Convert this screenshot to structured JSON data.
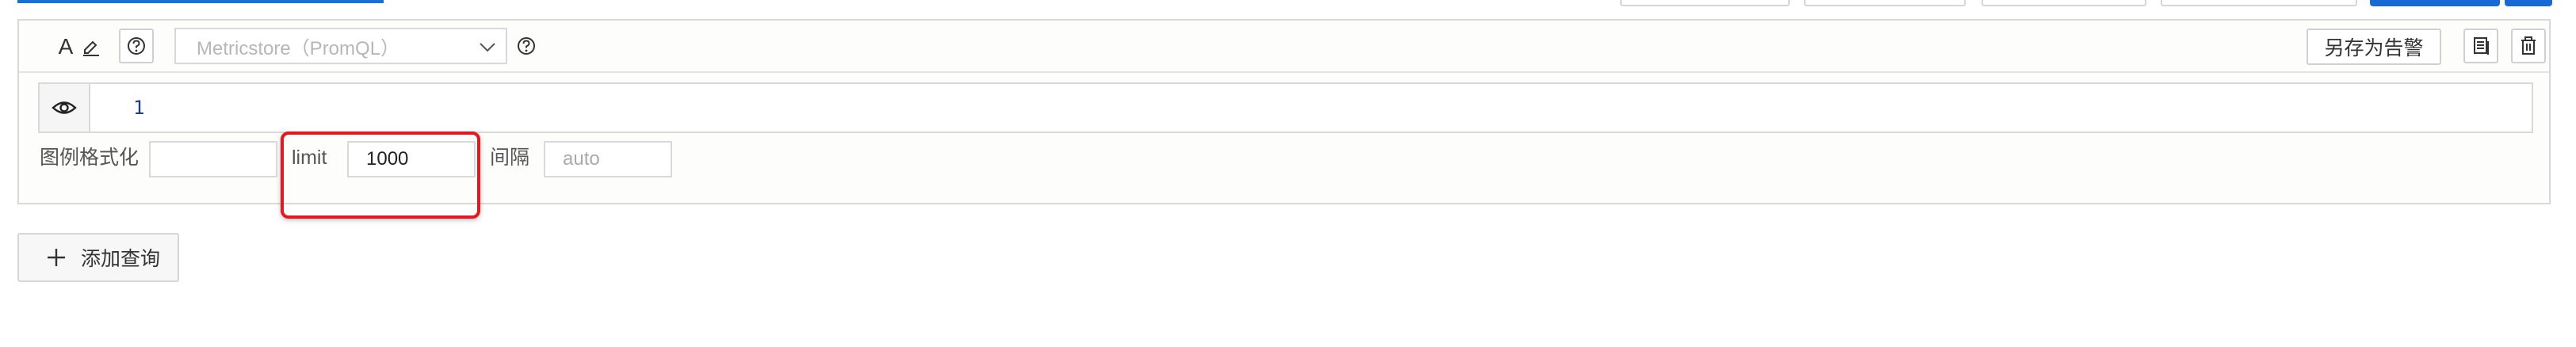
{
  "toolbar": {
    "text_mode_label": "A",
    "datasource_placeholder": "Metricstore（PromQL）",
    "save_alarm_label": "另存为告警",
    "icons": [
      "text-icon",
      "edit-icon",
      "help-icon",
      "chevron-down-icon",
      "help-icon",
      "copy-icon",
      "trash-icon"
    ]
  },
  "query": {
    "line_number": "1",
    "visibility_icon": "eye-icon"
  },
  "options": {
    "legend_label": "图例格式化",
    "legend_value": "",
    "limit_label": "limit",
    "limit_value": "1000",
    "interval_label": "间隔",
    "interval_placeholder": "auto"
  },
  "add_query_label": "添加查询",
  "colors": {
    "highlight": "#e5171f",
    "primary": "#1769d6",
    "border": "#d9d9d9",
    "query_text": "#1f3a8f"
  }
}
